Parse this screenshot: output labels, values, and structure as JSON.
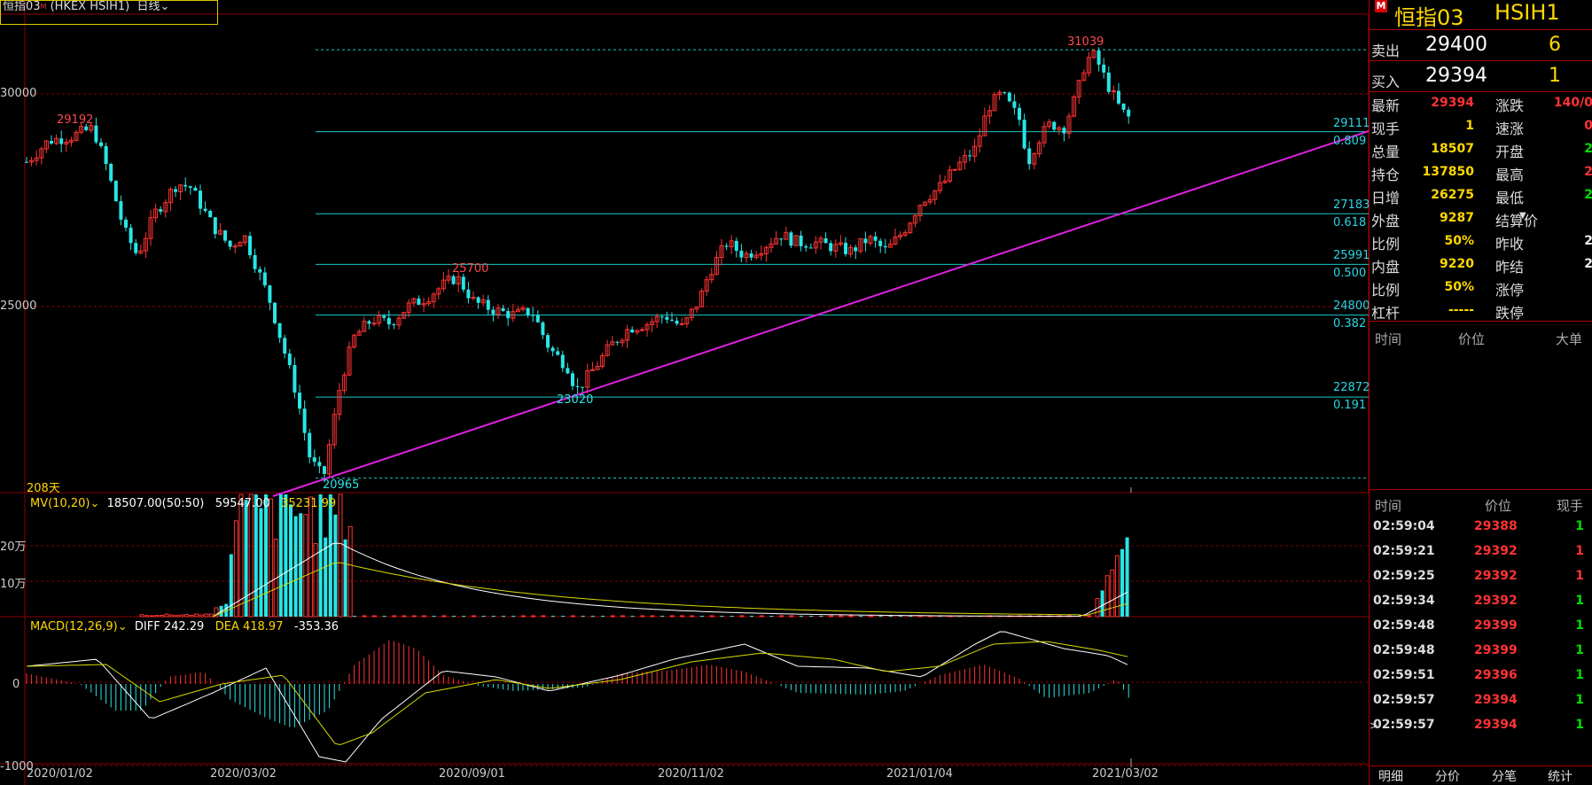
{
  "chart_title": {
    "name": "恒指03",
    "superscript": "M",
    "code": "(HKEX HSIH1)",
    "period": "日线",
    "period_chevron_icon": "chevron-down-icon"
  },
  "colors": {
    "up": "#ff3333",
    "down": "#29e5e5",
    "trendline": "#e020e0",
    "fib": "#19c8c8",
    "grid": "#8a0000",
    "ma1": "#ffffff",
    "ma2": "#d9d900"
  },
  "main_chart": {
    "y_axis_labels": [
      "30000",
      "25000"
    ],
    "high_label": "31039",
    "low_label": "20965",
    "label_29192": "29192",
    "label_25700": "25700",
    "label_23020": "23020",
    "bars_label": "208天",
    "fib_levels": [
      {
        "value": "29111",
        "ratio": "0.809",
        "price": 29111
      },
      {
        "value": "27183",
        "ratio": "0.618",
        "price": 27183
      },
      {
        "value": "25991",
        "ratio": "0.500",
        "price": 25991
      },
      {
        "value": "24800",
        "ratio": "0.382",
        "price": 24800
      },
      {
        "value": "22872",
        "ratio": "0.191",
        "price": 22872
      }
    ]
  },
  "volume_panel": {
    "indicator": "MV(10,20)",
    "chevron_icon": "chevron-down-icon",
    "value1": "18507.00(50:50)",
    "value2": "59547.00",
    "value3": "35231.99",
    "y_labels": [
      "20万",
      "10万"
    ]
  },
  "macd_panel": {
    "indicator": "MACD(12,26,9)",
    "chevron_icon": "chevron-down-icon",
    "diff": "DIFF 242.29",
    "dea": "DEA 418.97",
    "macd": "-353.36",
    "y_labels": [
      "0",
      "-1000"
    ]
  },
  "x_axis_dates": [
    "2020/01/02",
    "2020/03/02",
    "2020/09/01",
    "2020/11/02",
    "2021/01/04",
    "2021/03/02"
  ],
  "quote_panel": {
    "market_badge": "M",
    "name": "恒指03",
    "code": "HSIH1",
    "ask_label": "卖出",
    "ask_price": "29400",
    "ask_volume": "6",
    "bid_label": "买入",
    "bid_price": "29394",
    "bid_volume": "1",
    "left_stats": [
      {
        "label": "最新",
        "value": "29394",
        "color": "red"
      },
      {
        "label": "现手",
        "value": "1",
        "color": "yel"
      },
      {
        "label": "总量",
        "value": "18507",
        "color": "yel"
      },
      {
        "label": "持仓",
        "value": "137850",
        "color": "yel"
      },
      {
        "label": "日增",
        "value": "26275",
        "color": "yel"
      },
      {
        "label": "外盘",
        "value": "9287",
        "color": "yel"
      },
      {
        "label": "比例",
        "value": "50%",
        "color": "yel"
      },
      {
        "label": "内盘",
        "value": "9220",
        "color": "yel"
      },
      {
        "label": "比例",
        "value": "50%",
        "color": "yel"
      },
      {
        "label": "杠杆",
        "value": "-----",
        "color": "yel"
      }
    ],
    "right_stats": [
      {
        "label": "涨跌",
        "value": "140/0",
        "color": "red"
      },
      {
        "label": "速涨",
        "value": "0",
        "color": "red"
      },
      {
        "label": "开盘",
        "value": "2",
        "color": "grn"
      },
      {
        "label": "最高",
        "value": "2",
        "color": "red"
      },
      {
        "label": "最低",
        "value": "2",
        "color": "grn"
      },
      {
        "label": "结算价",
        "value": "",
        "color": "wht"
      },
      {
        "label": "昨收",
        "value": "2",
        "color": "wht"
      },
      {
        "label": "昨结",
        "value": "2",
        "color": "wht"
      },
      {
        "label": "涨停",
        "value": "",
        "color": "wht"
      },
      {
        "label": "跌停",
        "value": "",
        "color": "wht"
      }
    ],
    "big_order_headers": {
      "time": "时间",
      "price": "价位",
      "big": "大单"
    },
    "ticks_headers": {
      "time": "时间",
      "price": "价位",
      "volume": "现手"
    },
    "ticks": [
      {
        "time": "02:59:04",
        "price": "29388",
        "volume": "1",
        "vcolor": "grn"
      },
      {
        "time": "02:59:21",
        "price": "29392",
        "volume": "1",
        "vcolor": "red"
      },
      {
        "time": "02:59:25",
        "price": "29392",
        "volume": "1",
        "vcolor": "red"
      },
      {
        "time": "02:59:34",
        "price": "29392",
        "volume": "1",
        "vcolor": "grn"
      },
      {
        "time": "02:59:48",
        "price": "29399",
        "volume": "1",
        "vcolor": "grn"
      },
      {
        "time": "02:59:48",
        "price": "29399",
        "volume": "1",
        "vcolor": "grn"
      },
      {
        "time": "02:59:51",
        "price": "29396",
        "volume": "1",
        "vcolor": "grn"
      },
      {
        "time": "02:59:57",
        "price": "29394",
        "volume": "1",
        "vcolor": "grn"
      },
      {
        "time": "02:59:57",
        "price": "29394",
        "volume": "1",
        "vcolor": "grn"
      }
    ],
    "tabs": [
      "明细",
      "分价",
      "分笔",
      "统计"
    ]
  }
}
